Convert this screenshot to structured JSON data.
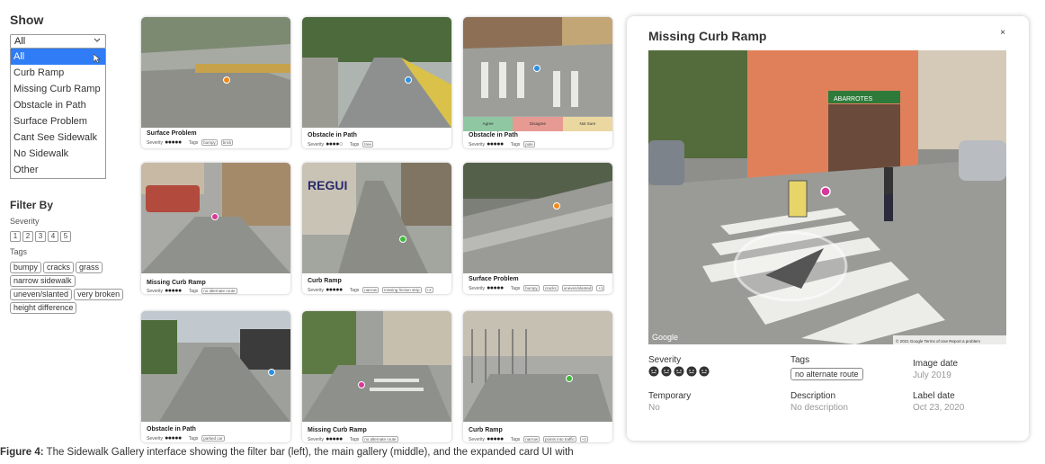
{
  "show": {
    "heading": "Show",
    "selected": "All",
    "options": [
      "All",
      "Curb Ramp",
      "Missing Curb Ramp",
      "Obstacle in Path",
      "Surface Problem",
      "Cant See Sidewalk",
      "No Sidewalk",
      "Other"
    ]
  },
  "filter": {
    "heading": "Filter By",
    "severity_label": "Severity",
    "severity_values": [
      "1",
      "2",
      "3",
      "4",
      "5"
    ],
    "tags_label": "Tags",
    "tags": [
      "bumpy",
      "cracks",
      "grass",
      "narrow sidewalk",
      "uneven/slanted",
      "very broken",
      "height difference"
    ]
  },
  "cards": [
    {
      "title": "Surface Problem",
      "severity_label": "Severity",
      "dots": "●●●●●",
      "tags_label": "Tags",
      "tags": [
        "bumpy",
        "brick"
      ]
    },
    {
      "title": "Obstacle in Path",
      "severity_label": "Severity",
      "dots": "●●●●○",
      "tags_label": "Tags",
      "tags": [
        "tree"
      ]
    },
    {
      "title": "Obstacle in Path",
      "severity_label": "Severity",
      "dots": "●●●●●",
      "tags_label": "Tags",
      "tags": [
        "pole"
      ],
      "vote": [
        "Agree",
        "Disagree",
        "Not Sure"
      ]
    },
    {
      "title": "Missing Curb Ramp",
      "severity_label": "Severity",
      "dots": "●●●●●",
      "tags_label": "Tags",
      "tags": [
        "no alternate route"
      ]
    },
    {
      "title": "Curb Ramp",
      "severity_label": "Severity",
      "dots": "●●●●●",
      "tags_label": "Tags",
      "tags": [
        "narrow",
        "missing friction strip",
        "+2"
      ]
    },
    {
      "title": "Surface Problem",
      "severity_label": "Severity",
      "dots": "●●●●●",
      "tags_label": "Tags",
      "tags": [
        "bumpy",
        "cracks",
        "uneven/slanted",
        "+1"
      ]
    },
    {
      "title": "Obstacle in Path",
      "severity_label": "Severity",
      "dots": "●●●●●",
      "tags_label": "Tags",
      "tags": [
        "parked car"
      ]
    },
    {
      "title": "Missing Curb Ramp",
      "severity_label": "Severity",
      "dots": "●●●●●",
      "tags_label": "Tags",
      "tags": [
        "no alternate route"
      ]
    },
    {
      "title": "Curb Ramp",
      "severity_label": "Severity",
      "dots": "●●●●●",
      "tags_label": "Tags",
      "tags": [
        "narrow",
        "points into traffic",
        "+2"
      ]
    }
  ],
  "panel": {
    "title": "Missing Curb Ramp",
    "close": "×",
    "prev": "<",
    "next": ">",
    "google": "Google",
    "copyright": "© 2021 Google  Terms of Use  Report a problem",
    "shop_sign": "ABARROTES",
    "severity_label": "Severity",
    "severity_level": 5,
    "tags_label": "Tags",
    "tag": "no alternate route",
    "image_date_label": "Image date",
    "image_date": "July 2019",
    "temporary_label": "Temporary",
    "temporary": "No",
    "description_label": "Description",
    "description": "No description",
    "label_date_label": "Label date",
    "label_date": "Oct 23, 2020"
  },
  "caption": {
    "lead": "Figure 4:",
    "text": " The Sidewalk Gallery interface showing the filter bar (left), the main gallery (middle), and the expanded card UI with"
  },
  "colors": {
    "selection": "#2f7cf6",
    "shop_orange": "#e0805a",
    "pin_pink": "#d8389a",
    "pin_blue": "#2c8fe0",
    "pin_green": "#3fba3f",
    "pin_orange": "#f08a1e"
  }
}
